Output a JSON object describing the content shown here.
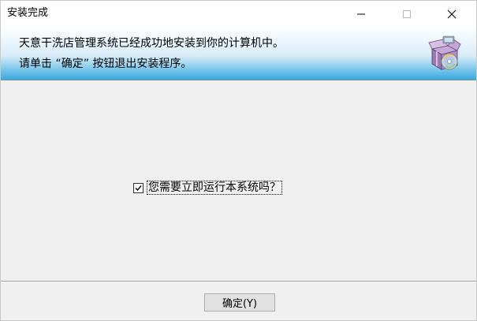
{
  "window": {
    "title": "安装完成",
    "controls": {
      "minimize_icon": "minimize-icon",
      "maximize_icon": "maximize-icon",
      "close_icon": "close-icon"
    }
  },
  "banner": {
    "line1": "天意干洗店管理系统已经成功地安装到你的计算机中。",
    "line2": "请单击 “确定” 按钮退出安装程序。",
    "icon": "installer-package-icon"
  },
  "options": {
    "run_now_label": "您需要立即运行本系统吗？",
    "run_now_checked": true
  },
  "footer": {
    "ok_label": "确定(Y)"
  },
  "colors": {
    "banner_gradient_top": "#ffffff",
    "banner_gradient_bottom": "#36a9e0",
    "dialog_background": "#f0f0f0",
    "button_background": "#e1e1e1"
  }
}
